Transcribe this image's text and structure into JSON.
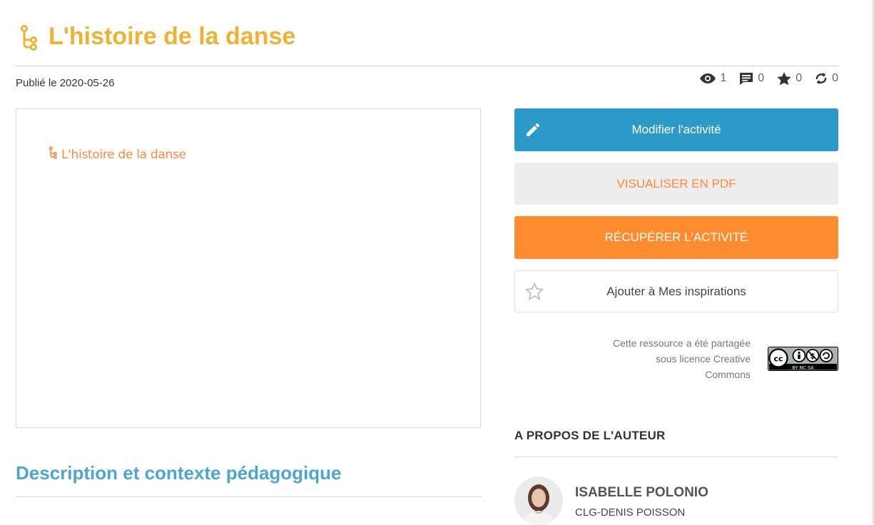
{
  "page": {
    "title": "L'histoire de la danse",
    "title_icon": "tree-branch-icon",
    "published": "Publié le 2020-05-26"
  },
  "stats": {
    "views": "1",
    "comments": "0",
    "favorites": "0",
    "shares": "0"
  },
  "preview": {
    "title": "L'histoire de la danse",
    "icon": "tree-branch-icon"
  },
  "actions": {
    "edit_label": "Modifier l'activité",
    "pdf_label": "VISUALISER EN PDF",
    "recover_label": "RÉCUPÉRER L'ACTIVITÉ",
    "inspire_label": "Ajouter à Mes inspirations"
  },
  "license": {
    "line1": "Cette ressource a été partagée",
    "line2": "sous licence Creative",
    "line3": "Commons",
    "badge_text": "BY NC SA"
  },
  "description": {
    "heading": "Description et contexte pédagogique"
  },
  "author": {
    "heading": "A PROPOS DE L'AUTEUR",
    "name": "ISABELLE POLONIO",
    "school": "CLG-DENIS POISSON"
  },
  "colors": {
    "title": "#f0b233",
    "edit_button": "#2c9ac9",
    "recover_button": "#ff8c2f",
    "pdf_text": "#ff8a3d",
    "description_heading": "#4da6cf"
  }
}
